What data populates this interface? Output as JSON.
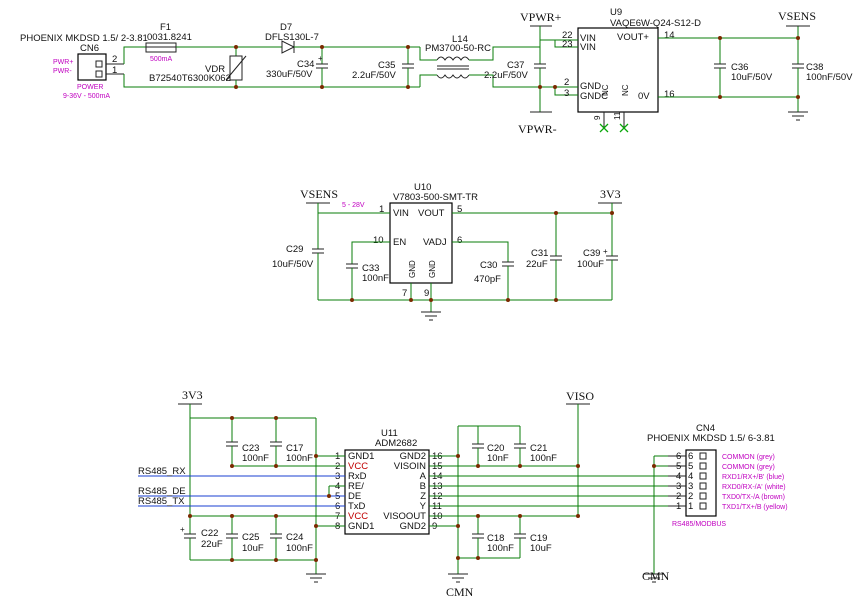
{
  "top": {
    "cn6": {
      "ref": "CN6",
      "value": "PHOENIX MKDSD 1.5/ 2-3.81",
      "pin2_label": "PWR+",
      "pin1_label": "PWR-",
      "note1": "POWER",
      "note2": "9-36V - 500mA",
      "pin2": "2",
      "pin1": "1"
    },
    "f1": {
      "ref": "F1",
      "value": "0031.8241",
      "rating": "500mA"
    },
    "vdr": {
      "ref": "VDR",
      "value": "B72540T6300K062"
    },
    "d7": {
      "ref": "D7",
      "value": "DFLS130L-7"
    },
    "c34": {
      "ref": "C34",
      "value": "330uF/50V"
    },
    "c35": {
      "ref": "C35",
      "value": "2.2uF/50V"
    },
    "l14": {
      "ref": "L14",
      "value": "PM3700-50-RC"
    },
    "c37": {
      "ref": "C37",
      "value": "2.2uF/50V"
    },
    "vpwr_plus": "VPWR+",
    "vpwr_minus": "VPWR-",
    "u9": {
      "ref": "U9",
      "value": "VAQE6W-Q24-S12-D",
      "vin1": "VIN",
      "vin2": "VIN",
      "gnd": "GND",
      "gnd2": "GNDC",
      "vout": "VOUT+",
      "ov": "0V",
      "nc1": "NC",
      "nc2": "NC",
      "p22": "22",
      "p23": "23",
      "p2": "2",
      "p3": "3",
      "p14": "14",
      "p16": "16",
      "p9": "9",
      "p11": "11"
    },
    "vsens": "VSENS",
    "c36": {
      "ref": "C36",
      "value": "10uF/50V"
    },
    "c38": {
      "ref": "C38",
      "value": "100nF/50V"
    }
  },
  "mid": {
    "vsens": "VSENS",
    "v3v3": "3V3",
    "range": "5 - 28V",
    "u10": {
      "ref": "U10",
      "value": "V7803-500-SMT-TR",
      "vin": "VIN",
      "vout": "VOUT",
      "en": "EN",
      "vadj": "VADJ",
      "gnd1": "GND",
      "gnd2": "GND",
      "p1": "1",
      "p5": "5",
      "p10": "10",
      "p6": "6",
      "p7": "7",
      "p9": "9"
    },
    "c29": {
      "ref": "C29",
      "value": "10uF/50V"
    },
    "c33": {
      "ref": "C33",
      "value": "100nF"
    },
    "c30": {
      "ref": "C30",
      "value": "470pF"
    },
    "c31": {
      "ref": "C31",
      "value": "22uF"
    },
    "c39": {
      "ref": "C39",
      "value": "100uF"
    }
  },
  "bot": {
    "v3v3": "3V3",
    "viso": "VISO",
    "cmn1": "CMN",
    "cmn2": "CMN",
    "rs485_rx": "RS485_RX",
    "rs485_de": "RS485_DE",
    "rs485_tx": "RS485_TX",
    "c23": {
      "ref": "C23",
      "value": "100nF"
    },
    "c17": {
      "ref": "C17",
      "value": "100nF"
    },
    "c22": {
      "ref": "C22",
      "value": "22uF"
    },
    "c25": {
      "ref": "C25",
      "value": "10uF"
    },
    "c24": {
      "ref": "C24",
      "value": "100nF"
    },
    "c20": {
      "ref": "C20",
      "value": "10nF"
    },
    "c21": {
      "ref": "C21",
      "value": "100nF"
    },
    "c18": {
      "ref": "C18",
      "value": "100nF"
    },
    "c19": {
      "ref": "C19",
      "value": "10uF"
    },
    "u11": {
      "ref": "U11",
      "value": "ADM2682",
      "left": [
        {
          "pin": "1",
          "name": "GND1"
        },
        {
          "pin": "2",
          "name": "VCC"
        },
        {
          "pin": "3",
          "name": "RxD"
        },
        {
          "pin": "4",
          "name": "RE/"
        },
        {
          "pin": "5",
          "name": "DE"
        },
        {
          "pin": "6",
          "name": "TxD"
        },
        {
          "pin": "7",
          "name": "VCC"
        },
        {
          "pin": "8",
          "name": "GND1"
        }
      ],
      "right": [
        {
          "pin": "16",
          "name": "GND2"
        },
        {
          "pin": "15",
          "name": "VISOIN"
        },
        {
          "pin": "14",
          "name": "A"
        },
        {
          "pin": "13",
          "name": "B"
        },
        {
          "pin": "12",
          "name": "Z"
        },
        {
          "pin": "11",
          "name": "Y"
        },
        {
          "pin": "10",
          "name": "VISOOUT"
        },
        {
          "pin": "9",
          "name": "GND2"
        }
      ]
    },
    "cn4": {
      "ref": "CN4",
      "value": "PHOENIX MKDSD 1.5/ 6-3.81",
      "label": "RS485/MODBUS",
      "pins": [
        {
          "n": "6",
          "desc": "COMMON (grey)"
        },
        {
          "n": "5",
          "desc": "COMMON (grey)"
        },
        {
          "n": "4",
          "desc": "RXD1/RX+/B' (blue)"
        },
        {
          "n": "3",
          "desc": "RXD0/RX-/A' (white)"
        },
        {
          "n": "2",
          "desc": "TXD0/TX-/A (brown)"
        },
        {
          "n": "1",
          "desc": "TXD1/TX+/B (yellow)"
        }
      ]
    }
  }
}
